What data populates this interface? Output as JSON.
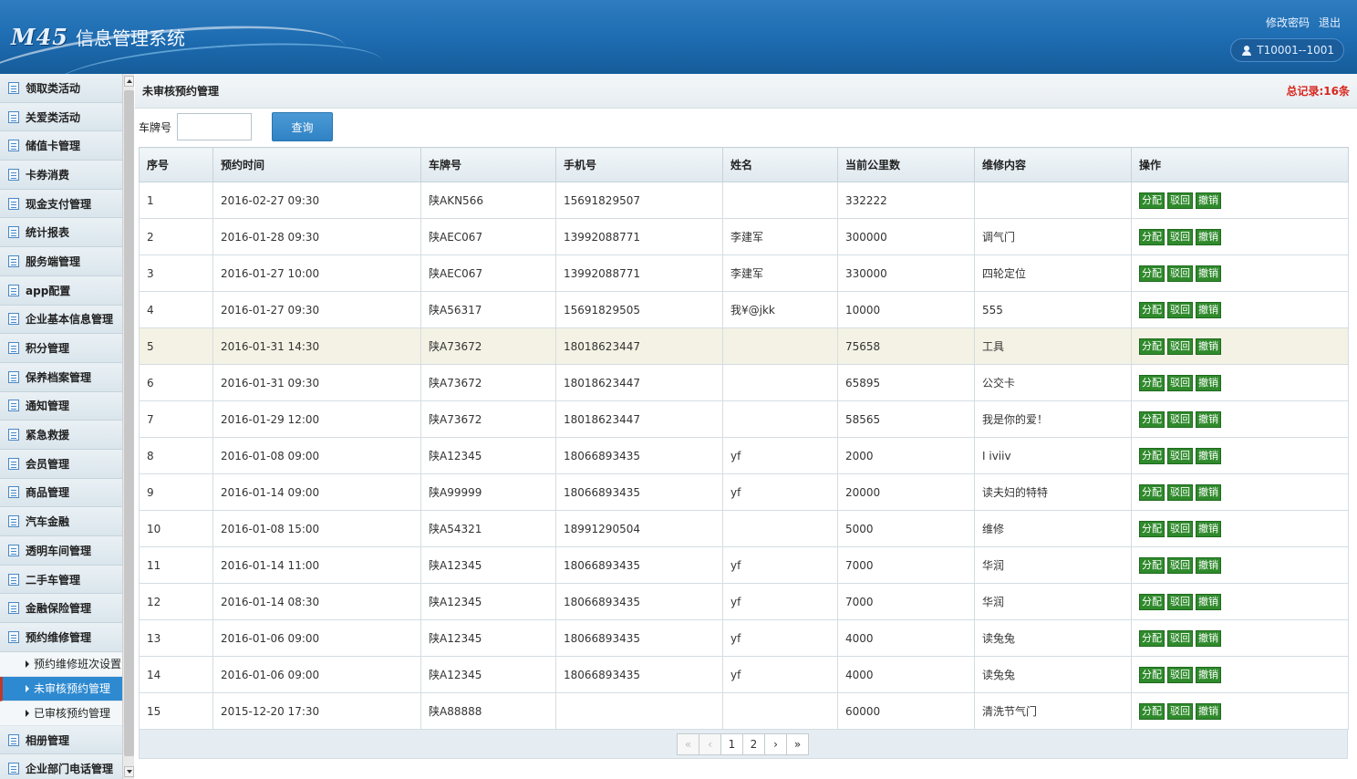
{
  "header": {
    "logo_mark": "M45",
    "app_title": "信息管理系统",
    "change_password": "修改密码",
    "logout": "退出",
    "user": "T10001--1001"
  },
  "sidebar": {
    "items": [
      {
        "label": "领取类活动"
      },
      {
        "label": "关爱类活动"
      },
      {
        "label": "储值卡管理"
      },
      {
        "label": "卡券消费"
      },
      {
        "label": "现金支付管理"
      },
      {
        "label": "统计报表"
      },
      {
        "label": "服务端管理"
      },
      {
        "label": "app配置"
      },
      {
        "label": "企业基本信息管理"
      },
      {
        "label": "积分管理"
      },
      {
        "label": "保养档案管理"
      },
      {
        "label": "通知管理"
      },
      {
        "label": "紧急救援"
      },
      {
        "label": "会员管理"
      },
      {
        "label": "商品管理"
      },
      {
        "label": "汽车金融"
      },
      {
        "label": "透明车间管理"
      },
      {
        "label": "二手车管理"
      },
      {
        "label": "金融保险管理"
      },
      {
        "label": "预约维修管理"
      }
    ],
    "sub_items": [
      {
        "label": "预约维修班次设置",
        "active": false
      },
      {
        "label": "未审核预约管理",
        "active": true
      },
      {
        "label": "已审核预约管理",
        "active": false
      }
    ],
    "after_items": [
      {
        "label": "相册管理"
      },
      {
        "label": "企业部门电话管理"
      }
    ]
  },
  "main": {
    "title": "未审核预约管理",
    "total": "总记录:16条",
    "search_label": "车牌号",
    "search_value": "",
    "search_button": "查询"
  },
  "table": {
    "columns": [
      "序号",
      "预约时间",
      "车牌号",
      "手机号",
      "姓名",
      "当前公里数",
      "维修内容",
      "操作"
    ],
    "actions": [
      "分配",
      "驳回",
      "撤销"
    ],
    "rows": [
      [
        "1",
        "2016-02-27 09:30",
        "陕AKN566",
        "15691829507",
        "",
        "332222",
        ""
      ],
      [
        "2",
        "2016-01-28 09:30",
        "陕AEC067",
        "13992088771",
        "李建军",
        "300000",
        "调气门"
      ],
      [
        "3",
        "2016-01-27 10:00",
        "陕AEC067",
        "13992088771",
        "李建军",
        "330000",
        "四轮定位"
      ],
      [
        "4",
        "2016-01-27 09:30",
        "陕A56317",
        "15691829505",
        "我¥@jkk",
        "10000",
        "555"
      ],
      [
        "5",
        "2016-01-31 14:30",
        "陕A73672",
        "18018623447",
        "",
        "75658",
        "工具"
      ],
      [
        "6",
        "2016-01-31 09:30",
        "陕A73672",
        "18018623447",
        "",
        "65895",
        "公交卡"
      ],
      [
        "7",
        "2016-01-29 12:00",
        "陕A73672",
        "18018623447",
        "",
        "58565",
        "我是你的爱！"
      ],
      [
        "8",
        "2016-01-08 09:00",
        "陕A12345",
        "18066893435",
        "yf",
        "2000",
        "I iviiv"
      ],
      [
        "9",
        "2016-01-14 09:00",
        "陕A99999",
        "18066893435",
        "yf",
        "20000",
        "读夫妇的特特"
      ],
      [
        "10",
        "2016-01-08 15:00",
        "陕A54321",
        "18991290504",
        "",
        "5000",
        "维修"
      ],
      [
        "11",
        "2016-01-14 11:00",
        "陕A12345",
        "18066893435",
        "yf",
        "7000",
        "华润"
      ],
      [
        "12",
        "2016-01-14 08:30",
        "陕A12345",
        "18066893435",
        "yf",
        "7000",
        "华润"
      ],
      [
        "13",
        "2016-01-06 09:00",
        "陕A12345",
        "18066893435",
        "yf",
        "4000",
        "读兔兔"
      ],
      [
        "14",
        "2016-01-06 09:00",
        "陕A12345",
        "18066893435",
        "yf",
        "4000",
        "读兔兔"
      ],
      [
        "15",
        "2015-12-20 17:30",
        "陕A88888",
        "",
        "",
        "60000",
        "清洗节气门"
      ]
    ],
    "highlighted_row": 5
  },
  "pager": {
    "first": "«",
    "prev": "‹",
    "pages": [
      "1",
      "2"
    ],
    "next": "›",
    "last": "»"
  }
}
